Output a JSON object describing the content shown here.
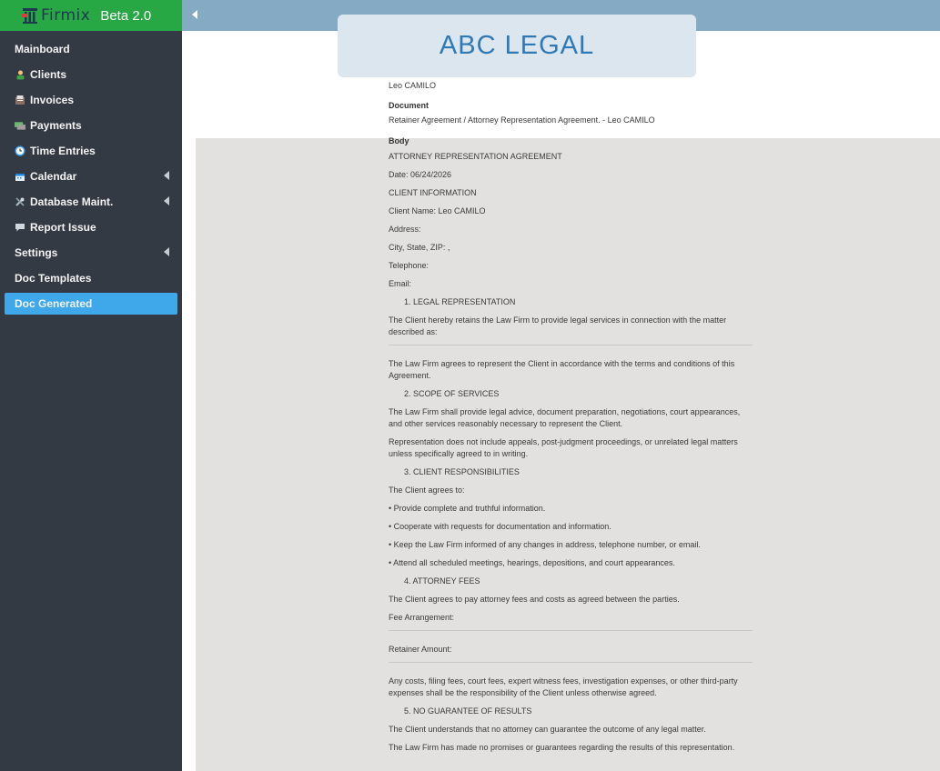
{
  "brand": {
    "name": "Firmix",
    "version": "Beta 2.0"
  },
  "colors": {
    "sidebar_bg": "#343a44",
    "brand_bg": "#28a745",
    "topbar_bg": "#85abc4",
    "active_item": "#3ea8ea",
    "header_title": "#2f79b5",
    "body_bg": "#e3e1df"
  },
  "sidebar": {
    "items": [
      {
        "label": "Mainboard",
        "icon": ""
      },
      {
        "label": "Clients",
        "icon": "clients-icon"
      },
      {
        "label": "Invoices",
        "icon": "invoices-icon"
      },
      {
        "label": "Payments",
        "icon": "payments-icon"
      },
      {
        "label": "Time Entries",
        "icon": "clock-icon"
      },
      {
        "label": "Calendar",
        "icon": "calendar-icon",
        "expandable": true
      },
      {
        "label": "Database Maint.",
        "icon": "tools-icon",
        "expandable": true
      },
      {
        "label": "Report Issue",
        "icon": "chat-icon"
      },
      {
        "label": "Settings",
        "icon": "",
        "expandable": true
      },
      {
        "label": "Doc Templates",
        "icon": ""
      },
      {
        "label": "Doc Generated",
        "icon": "",
        "active": true
      }
    ]
  },
  "header": {
    "title": "ABC LEGAL"
  },
  "document": {
    "client_name": "Leo CAMILO",
    "doc_label": "Document",
    "doc_value": "Retainer Agreement / Attorney Representation Agreement. - Leo CAMILO",
    "body_label": "Body",
    "lines": [
      "ATTORNEY REPRESENTATION AGREEMENT",
      "Date: 06/24/2026",
      "CLIENT INFORMATION",
      "Client Name: Leo CAMILO",
      "Address:",
      "City, State, ZIP: ,",
      "Telephone:",
      "Email:",
      "1. LEGAL REPRESENTATION",
      "The Client hereby retains the Law Firm to provide legal services in connection with the matter described as:",
      "The Law Firm agrees to represent the Client in accordance with the terms and conditions of this Agreement.",
      "2. SCOPE OF SERVICES",
      "The Law Firm shall provide legal advice, document preparation, negotiations, court appearances, and other services reasonably necessary to represent the Client.",
      "Representation does not include appeals, post-judgment proceedings, or unrelated legal matters unless specifically agreed to in writing.",
      "3. CLIENT RESPONSIBILITIES",
      "The Client agrees to:",
      "• Provide complete and truthful information.",
      "• Cooperate with requests for documentation and information.",
      "• Keep the Law Firm informed of any changes in address, telephone number, or email.",
      "• Attend all scheduled meetings, hearings, depositions, and court appearances.",
      "4. ATTORNEY FEES",
      "The Client agrees to pay attorney fees and costs as agreed between the parties.",
      "Fee Arrangement:",
      "Retainer Amount:",
      "Any costs, filing fees, court fees, expert witness fees, investigation expenses, or other third-party expenses shall be the responsibility of the Client unless otherwise agreed.",
      "5. NO GUARANTEE OF RESULTS",
      "The Client understands that no attorney can guarantee the outcome of any legal matter.",
      "The Law Firm has made no promises or guarantees regarding the results of this representation."
    ]
  }
}
